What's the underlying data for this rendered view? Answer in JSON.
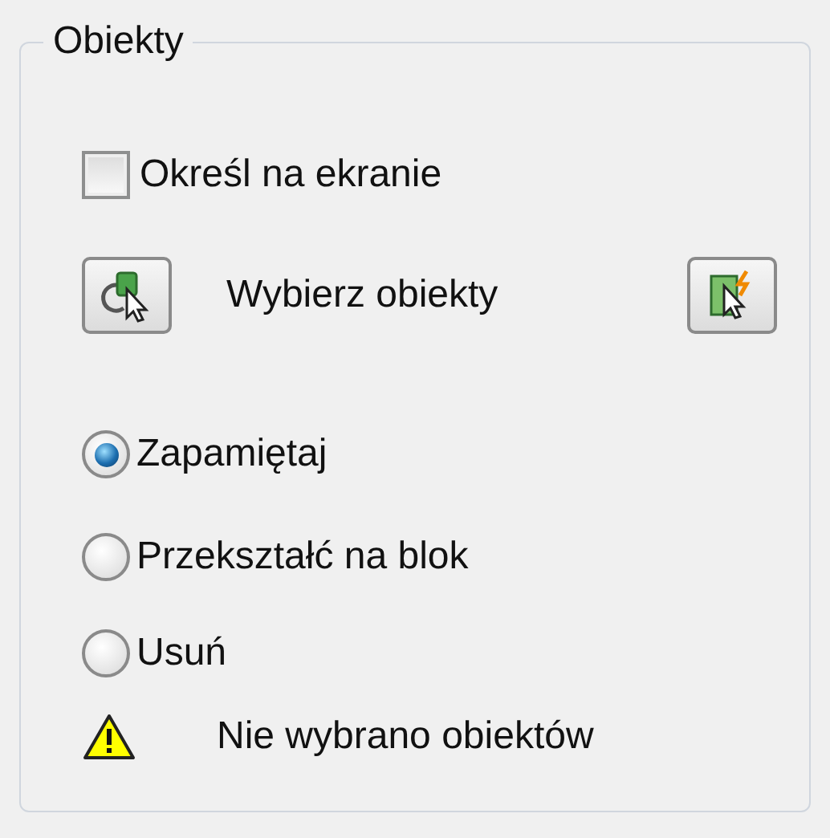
{
  "group": {
    "title": "Obiekty"
  },
  "specify_on_screen": {
    "label": "Określ na ekranie",
    "checked": false
  },
  "select_objects": {
    "label": "Wybierz obiekty"
  },
  "options": [
    {
      "label": "Zapamiętaj",
      "selected": true
    },
    {
      "label": "Przekształć na blok",
      "selected": false
    },
    {
      "label": "Usuń",
      "selected": false
    }
  ],
  "status": {
    "message": "Nie wybrano obiektów"
  }
}
